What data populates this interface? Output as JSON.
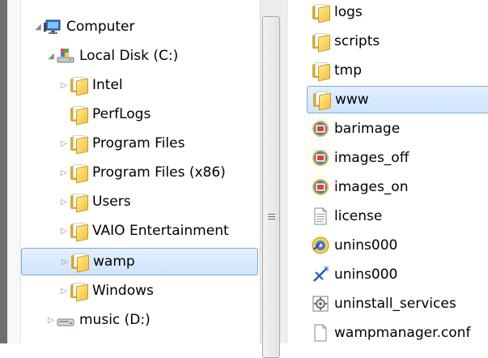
{
  "tree": {
    "items": [
      {
        "label": "Computer",
        "icon": "computer-icon",
        "expander": "expanded"
      },
      {
        "label": "Local Disk (C:)",
        "icon": "drive-icon",
        "expander": "expanded"
      },
      {
        "label": "Intel",
        "icon": "folder-icon",
        "expander": "collapsed"
      },
      {
        "label": "PerfLogs",
        "icon": "folder-icon",
        "expander": "none"
      },
      {
        "label": "Program Files",
        "icon": "folder-icon",
        "expander": "collapsed"
      },
      {
        "label": "Program Files (x86)",
        "icon": "folder-icon",
        "expander": "collapsed"
      },
      {
        "label": "Users",
        "icon": "folder-icon",
        "expander": "collapsed"
      },
      {
        "label": "VAIO Entertainment",
        "icon": "folder-icon",
        "expander": "collapsed"
      },
      {
        "label": "wamp",
        "icon": "folder-icon",
        "expander": "collapsed",
        "selected": true
      },
      {
        "label": "Windows",
        "icon": "folder-icon",
        "expander": "collapsed"
      },
      {
        "label": "music (D:)",
        "icon": "removable-drive-icon",
        "expander": "collapsed"
      }
    ]
  },
  "files": {
    "items": [
      {
        "label": "logs",
        "icon": "folder-icon"
      },
      {
        "label": "scripts",
        "icon": "folder-icon"
      },
      {
        "label": "tmp",
        "icon": "folder-icon"
      },
      {
        "label": "www",
        "icon": "folder-icon",
        "selected": true
      },
      {
        "label": "barimage",
        "icon": "image-shortcut-icon"
      },
      {
        "label": "images_off",
        "icon": "image-shortcut-icon"
      },
      {
        "label": "images_on",
        "icon": "image-shortcut-icon"
      },
      {
        "label": "license",
        "icon": "text-file-icon"
      },
      {
        "label": "unins000",
        "icon": "setup-disc-icon"
      },
      {
        "label": "unins000",
        "icon": "uninstall-icon"
      },
      {
        "label": "uninstall_services",
        "icon": "batch-file-icon"
      },
      {
        "label": "wampmanager.conf",
        "icon": "blank-file-icon"
      }
    ]
  },
  "colors": {
    "selection_border": "#7fa9d9",
    "selection_fill": "#cfe4fd",
    "folder_yellow": "#f3c443"
  }
}
